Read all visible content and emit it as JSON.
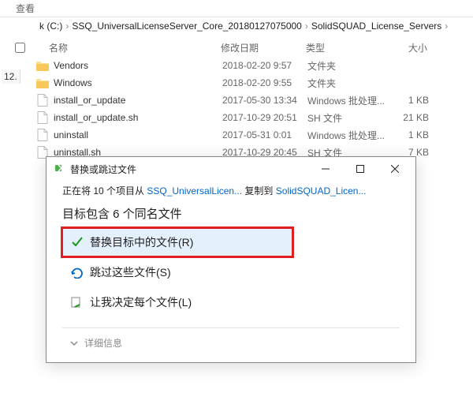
{
  "toolbar": {
    "view": "查看"
  },
  "breadcrumb": {
    "p1": "k (C:)",
    "p2": "SSQ_UniversalLicenseServer_Core_20180127075000",
    "p3": "SolidSQUAD_License_Servers"
  },
  "headers": {
    "name": "名称",
    "date": "修改日期",
    "type": "类型",
    "size": "大小"
  },
  "files": {
    "r0": {
      "name": "Vendors",
      "date": "2018-02-20 9:57",
      "type": "文件夹",
      "size": "",
      "kind": "folder"
    },
    "r1": {
      "name": "Windows",
      "date": "2018-02-20 9:55",
      "type": "文件夹",
      "size": "",
      "kind": "folder"
    },
    "r2": {
      "name": "install_or_update",
      "date": "2017-05-30 13:34",
      "type": "Windows 批处理...",
      "size": "1 KB",
      "kind": "file"
    },
    "r3": {
      "name": "install_or_update.sh",
      "date": "2017-10-29 20:51",
      "type": "SH 文件",
      "size": "21 KB",
      "kind": "file"
    },
    "r4": {
      "name": "uninstall",
      "date": "2017-05-31 0:01",
      "type": "Windows 批处理...",
      "size": "1 KB",
      "kind": "file"
    },
    "r5": {
      "name": "uninstall.sh",
      "date": "2017-10-29 20:45",
      "type": "SH 文件",
      "size": "7 KB",
      "kind": "file"
    }
  },
  "sidebar_marker": "12.",
  "dialog": {
    "title": "替换或跳过文件",
    "progress_prefix": "正在将 10 个项目从 ",
    "progress_src": "SSQ_UniversalLicen...",
    "progress_mid": " 复制到 ",
    "progress_dst": "SolidSQUAD_Licen...",
    "subtitle": "目标包含 6 个同名文件",
    "opt_replace": "替换目标中的文件(R)",
    "opt_skip": "跳过这些文件(S)",
    "opt_decide": "让我决定每个文件(L)",
    "details": "详细信息"
  }
}
